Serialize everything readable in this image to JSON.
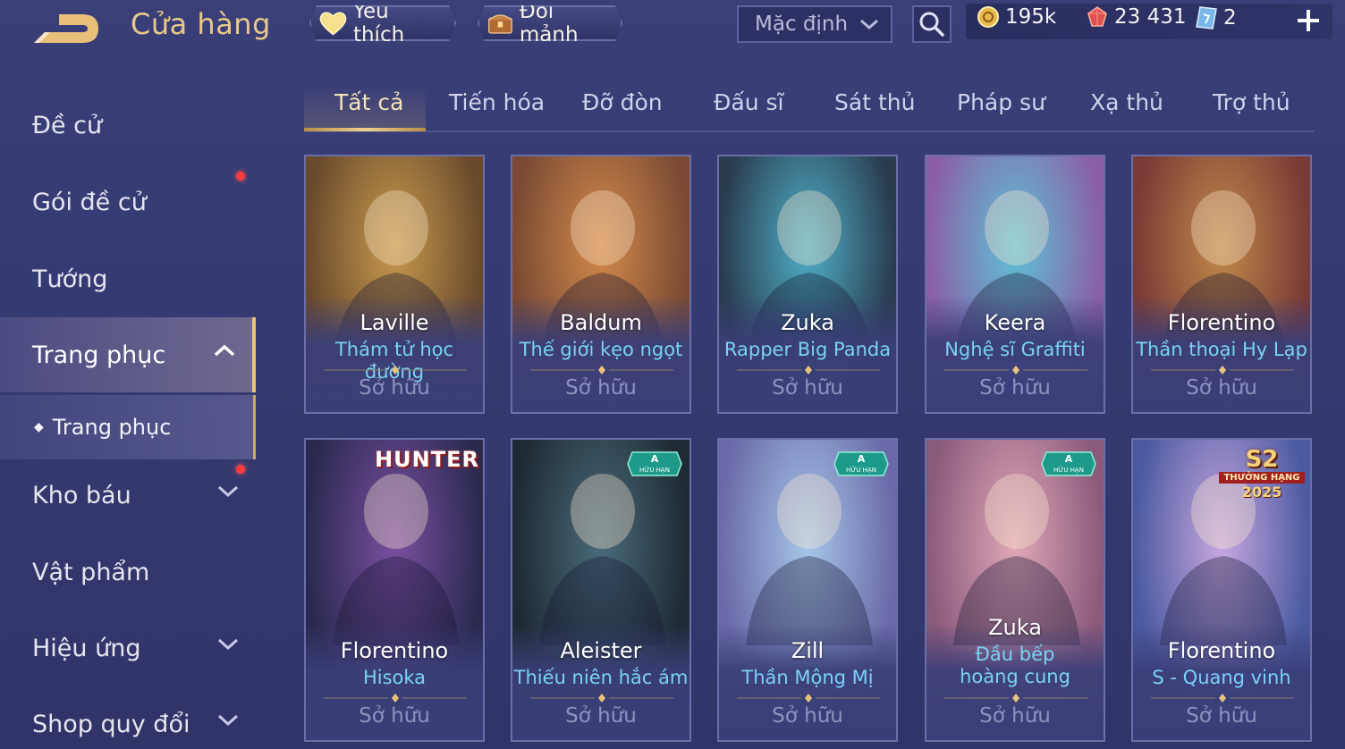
{
  "header": {
    "title": "Cửa hàng",
    "favorites_label": "Yêu thích",
    "exchange_label": "Đổi mảnh",
    "sort": {
      "selected": "Mặc định"
    },
    "currencies": {
      "gold": "195k",
      "gems": "23 431",
      "tickets": "2"
    }
  },
  "sidebar": {
    "items": [
      {
        "label": "Đề cử"
      },
      {
        "label": "Gói đề cử"
      },
      {
        "label": "Tướng"
      },
      {
        "label": "Trang phục"
      },
      {
        "label": "Kho báu"
      },
      {
        "label": "Vật phẩm"
      },
      {
        "label": "Hiệu ứng"
      },
      {
        "label": "Shop quy đổi"
      }
    ],
    "sub_item": "Trang phục"
  },
  "tabs": [
    "Tất cả",
    "Tiến hóa",
    "Đỡ đòn",
    "Đấu sĩ",
    "Sát thủ",
    "Pháp sư",
    "Xạ thủ",
    "Trợ thủ"
  ],
  "cards": [
    {
      "hero": "Laville",
      "skin": "Thám tử học đường",
      "status": "Sở hữu",
      "colors": [
        "#c79a4e",
        "#6a4a2c"
      ]
    },
    {
      "hero": "Baldum",
      "skin": "Thế giới kẹo ngọt",
      "status": "Sở hữu",
      "colors": [
        "#d38a4a",
        "#7a4a34"
      ]
    },
    {
      "hero": "Zuka",
      "skin": "Rapper Big Panda",
      "status": "Sở hữu",
      "colors": [
        "#4fb0c8",
        "#2a3b4e"
      ]
    },
    {
      "hero": "Keera",
      "skin": "Nghệ sĩ Graffiti",
      "status": "Sở hữu",
      "colors": [
        "#5fc2d4",
        "#8a5fa8"
      ]
    },
    {
      "hero": "Florentino",
      "skin": "Thần thoại Hy Lạp",
      "status": "Sở hữu",
      "colors": [
        "#c08a4a",
        "#7a3a36"
      ]
    },
    {
      "hero": "Florentino",
      "skin": "Hisoka",
      "status": "Sở hữu",
      "banner": "HUNTER",
      "colors": [
        "#7a4fa0",
        "#2a2a50"
      ]
    },
    {
      "hero": "Aleister",
      "skin": "Thiếu niên hắc ám",
      "status": "Sở hữu",
      "badge": "A",
      "badge_sub": "HỮU HẠN",
      "colors": [
        "#4a6a7a",
        "#1e2a34"
      ]
    },
    {
      "hero": "Zill",
      "skin": "Thần Mộng Mị",
      "status": "Sở hữu",
      "badge": "A",
      "badge_sub": "HỮU HẠN",
      "colors": [
        "#a6c6e8",
        "#6a6aa8"
      ]
    },
    {
      "hero": "Zuka",
      "skin": "Đầu bếp hoàng cung",
      "status": "Sở hữu",
      "badge": "A",
      "badge_sub": "HỮU HẠN",
      "colors": [
        "#e0a8b8",
        "#8a5a7a"
      ]
    },
    {
      "hero": "Florentino",
      "skin": "S - Quang vinh",
      "status": "Sở hữu",
      "season": "S2",
      "season_sub": "THƯỞNG HẠNG",
      "season_year": "2025",
      "colors": [
        "#c8a8e0",
        "#4a5aa0"
      ]
    }
  ]
}
